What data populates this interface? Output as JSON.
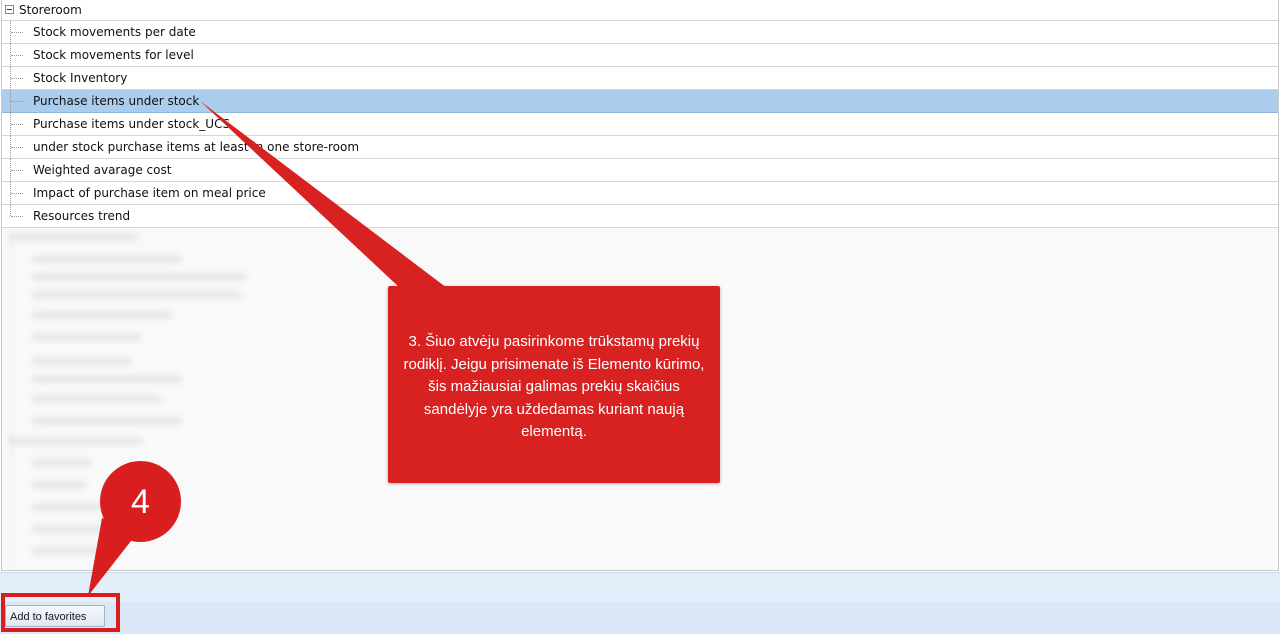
{
  "tree": {
    "root_label": "Storeroom",
    "items": [
      {
        "label": "Stock movements per date",
        "selected": false
      },
      {
        "label": "Stock movements for level",
        "selected": false
      },
      {
        "label": "Stock Inventory",
        "selected": false
      },
      {
        "label": "Purchase items under stock",
        "selected": true
      },
      {
        "label": "Purchase items under stock_UCS",
        "selected": false
      },
      {
        "label": "under stock purchase items at least in one store-room",
        "selected": false
      },
      {
        "label": "Weighted avarage cost",
        "selected": false
      },
      {
        "label": "Impact of purchase item on meal price",
        "selected": false
      },
      {
        "label": "Resources trend",
        "selected": false
      }
    ]
  },
  "callout": {
    "text": "3. Šiuo atvėju pasirinkome trūkstamų prekių rodiklį. Jeigu prisimenate iš Elemento kūrimo, šis mažiausiai galimas prekių skaičius sandėlyje yra uždedamas kuriant naują elementą.",
    "color": "#d82222"
  },
  "step_marker": {
    "number": "4",
    "color": "#d81e1e"
  },
  "footer": {
    "add_to_favorites_label": "Add to favorites"
  },
  "colors": {
    "selection": "#aacdee",
    "footer_background": "#dae7f6"
  }
}
